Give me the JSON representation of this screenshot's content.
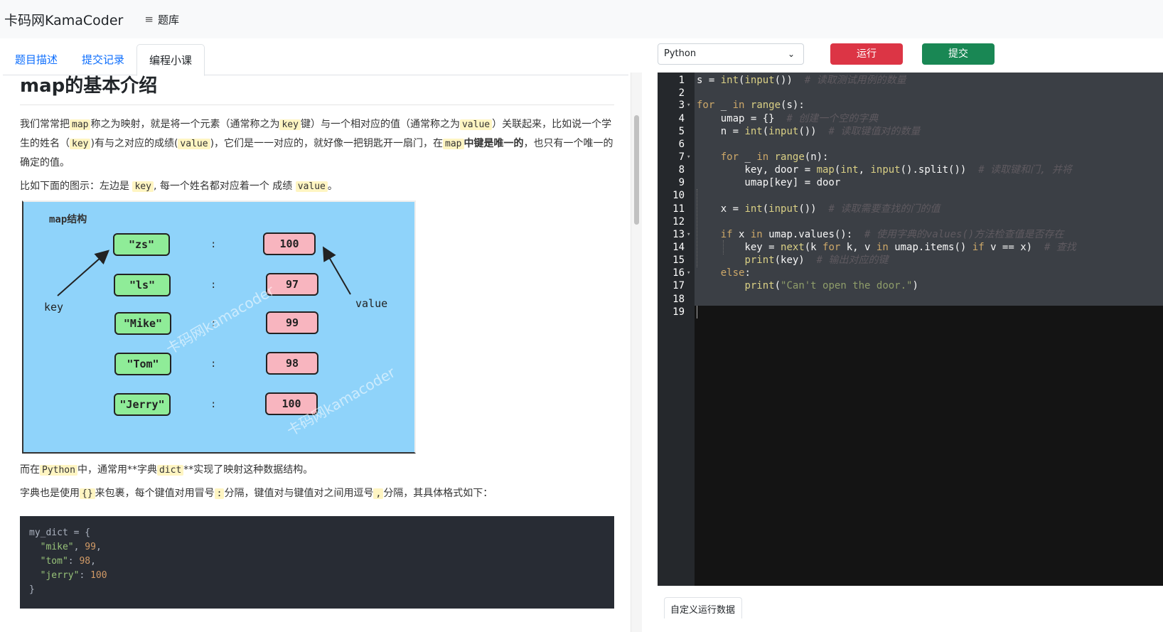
{
  "header": {
    "brand": "卡码网KamaCoder",
    "nav_label": "题库"
  },
  "tabs": [
    {
      "label": "题目描述"
    },
    {
      "label": "提交记录"
    },
    {
      "label": "编程小课"
    }
  ],
  "article": {
    "title": "map的基本介绍",
    "p1": {
      "t1": "我们常常把",
      "c1": "map",
      "t2": "称之为映射，就是将一个元素（通常称之为",
      "c2": "key",
      "t3": "键）与一个相对应的值（通常称之为",
      "c3": "value",
      "t4": "）关联起来，比如说一个学生的姓名（",
      "c4": "key",
      "t5": ")有与之对应的成绩(",
      "c5": "value",
      "t6": ")，它们是一一对应的，就好像一把钥匙开一扇门，在",
      "c6": "map",
      "b1": "中键是唯一的",
      "t7": "，也只有一个唯一的确定的值。"
    },
    "p2": {
      "t1": "比如下面的图示：左边是 ",
      "c1": "key",
      "t2": ", 每一个姓名都对应着一个 成绩 ",
      "c2": "value",
      "t3": "。"
    },
    "diagram": {
      "title": "map结构",
      "keys": [
        "\"zs\"",
        "\"ls\"",
        "\"Mike\"",
        "\"Tom\"",
        "\"Jerry\""
      ],
      "values": [
        "100",
        "97",
        "99",
        "98",
        "100"
      ],
      "colon": ":",
      "key_label": "key",
      "value_label": "value",
      "watermark": "卡码网kamacoder"
    },
    "p3": {
      "t1": "而在",
      "c1": "Python",
      "t2": "中，通常用**字典",
      "c2": "dict",
      "t3": "**实现了映射这种数据结构。"
    },
    "p4": {
      "t1": "字典也是使用",
      "c1": "{}",
      "t2": "来包裹，每个键值对用冒号",
      "c2": ":",
      "t3": "分隔，键值对与键值对之间用逗号",
      "c3": ",",
      "t4": "分隔，其具体格式如下："
    },
    "code_sample": {
      "l1": "my_dict = {",
      "k1": "\"mike\"",
      "v1": "99",
      "k2": "\"tom\"",
      "v2": "98",
      "k3": "\"jerry\"",
      "v3": "100",
      "l5": "}"
    }
  },
  "toolbar": {
    "language": "Python",
    "run_label": "运行",
    "submit_label": "提交"
  },
  "editor": {
    "line_numbers": [
      "1",
      "2",
      "3",
      "4",
      "5",
      "6",
      "7",
      "8",
      "9",
      "10",
      "11",
      "12",
      "13",
      "14",
      "15",
      "16",
      "17",
      "18",
      "19"
    ],
    "l1": {
      "a": "s",
      "b": " = ",
      "c": "int",
      "d": "(",
      "e": "input",
      "f": "())  ",
      "cm": "# 读取测试用例的数量"
    },
    "l3": {
      "kw": "for",
      "a": " _ ",
      "kw2": "in",
      "sp": " ",
      "fn": "range",
      "b": "(s):"
    },
    "l4": {
      "a": "    umap = {}  ",
      "cm": "# 创建一个空的字典"
    },
    "l5": {
      "a": "    n = ",
      "fn": "int",
      "b": "(",
      "fn2": "input",
      "c": "())  ",
      "cm": "# 读取键值对的数量"
    },
    "l7": {
      "a": "    ",
      "kw": "for",
      "b": " _ ",
      "kw2": "in",
      "sp": " ",
      "fn": "range",
      "c": "(n):"
    },
    "l8": {
      "a": "        key, door = ",
      "fn": "map",
      "b": "(",
      "fn2": "int",
      "c": ", ",
      "fn3": "input",
      "d": "().split())  ",
      "cm": "# 读取键和门, 并将"
    },
    "l9": {
      "a": "        umap[key] = door"
    },
    "l11": {
      "a": "    x = ",
      "fn": "int",
      "b": "(",
      "fn2": "input",
      "c": "())  ",
      "cm": "# 读取需要查找的门的值"
    },
    "l13": {
      "a": "    ",
      "kw": "if",
      "b": " x ",
      "kw2": "in",
      "c": " umap.values():  ",
      "cm": "# 使用字典的values()方法检查值是否存在"
    },
    "l14": {
      "a": "        key = ",
      "fn": "next",
      "b": "(k ",
      "kw": "for",
      "c": " k, v ",
      "kw2": "in",
      "d": " umap.items() ",
      "kw3": "if",
      "e": " v == x)  ",
      "cm": "# 查找"
    },
    "l15": {
      "a": "        ",
      "fn": "print",
      "b": "(key)  ",
      "cm": "# 输出对应的键"
    },
    "l16": {
      "a": "    ",
      "kw": "else",
      "b": ":"
    },
    "l17": {
      "a": "        ",
      "fn": "print",
      "b": "(",
      "str": "\"Can't open the door.\"",
      "c": ")"
    }
  },
  "custom_data_tab": "自定义运行数据"
}
